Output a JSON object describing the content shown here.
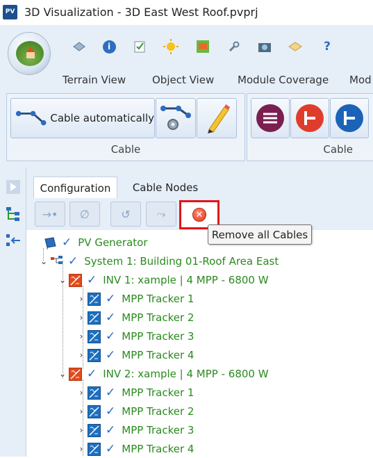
{
  "window": {
    "title": "3D Visualization - 3D East West Roof.pvprj",
    "app_icon_text": "PV"
  },
  "ribbon": {
    "quick_access": [
      "eye-icon",
      "info-icon",
      "checklist-icon",
      "sun-icon",
      "map-icon",
      "wrench-icon",
      "camera-icon",
      "diamond-icon",
      "help-icon"
    ],
    "help_glyph": "?",
    "info_glyph": "i",
    "tabs": [
      "Terrain View",
      "Object View",
      "Module Coverage",
      "Mod"
    ],
    "groups": [
      {
        "label": "Cable",
        "button_label": "Cable automatically"
      },
      {
        "label": "Cable"
      }
    ]
  },
  "panel": {
    "tabs": [
      "Configuration",
      "Cable Nodes"
    ],
    "toolbar": {
      "buttons": [
        "→•",
        "∅",
        "↺",
        "⤳"
      ],
      "remove_tooltip": "Remove all Cables"
    },
    "tree": [
      {
        "label": "PV Generator"
      },
      {
        "label": "System 1:  Building 01-Roof Area East"
      },
      {
        "label": "INV 1: xample | 4 MPP - 6800 W"
      },
      {
        "label": "MPP Tracker 1"
      },
      {
        "label": "MPP Tracker 2"
      },
      {
        "label": "MPP Tracker 3"
      },
      {
        "label": "MPP Tracker 4"
      },
      {
        "label": "INV 2: xample | 4 MPP - 6800 W"
      },
      {
        "label": "MPP Tracker 1"
      },
      {
        "label": "MPP Tracker 2"
      },
      {
        "label": "MPP Tracker 3"
      },
      {
        "label": "MPP Tracker 4"
      }
    ]
  },
  "colors": {
    "accent": "#e3141a",
    "tree_text": "#2a8a1e",
    "ribbon_bg": "#e6eef8"
  }
}
